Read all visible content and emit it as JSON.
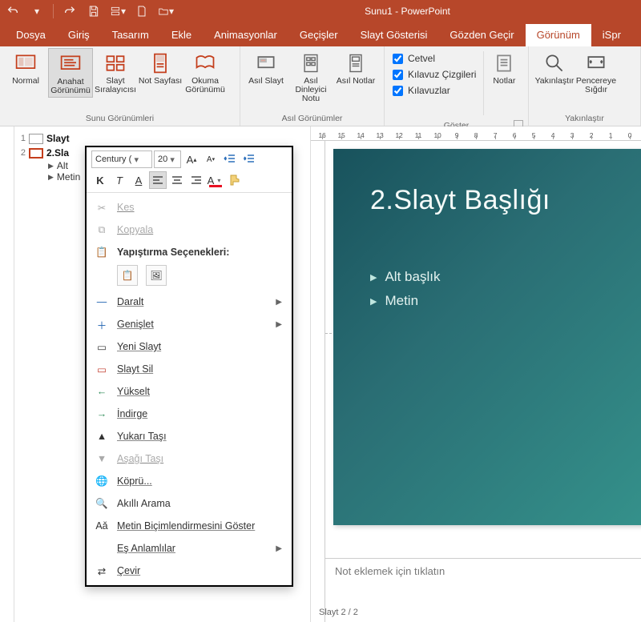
{
  "titlebar": {
    "title": "Sunu1 - PowerPoint"
  },
  "tabs": {
    "file": "Dosya",
    "home": "Giriş",
    "design": "Tasarım",
    "insert": "Ekle",
    "anim": "Animasyonlar",
    "trans": "Geçişler",
    "show": "Slayt Gösterisi",
    "review": "Gözden Geçir",
    "view": "Görünüm",
    "ispring": "iSpr"
  },
  "ribbon": {
    "group_pres_views": "Sunu Görünümleri",
    "group_master_views": "Asıl Görünümler",
    "group_show": "Göster",
    "group_zoom": "Yakınlaştır",
    "btn_normal": "Normal",
    "btn_outline": "Anahat Görünümü",
    "btn_sorter": "Slayt Sıralayıcısı",
    "btn_notespage": "Not Sayfası",
    "btn_reading": "Okuma Görünümü",
    "btn_slidemaster": "Asıl Slayt",
    "btn_handoutmaster": "Asıl Dinleyici Notu",
    "btn_notesmaster": "Asıl Notlar",
    "chk_ruler": "Cetvel",
    "chk_gridlines": "Kılavuz Çizgileri",
    "chk_guides": "Kılavuzlar",
    "btn_notes": "Notlar",
    "btn_zoom": "Yakınlaştır",
    "btn_fit": "Pencereye Sığdır"
  },
  "outline": {
    "s1_num": "1",
    "s1_title": "Slayt",
    "s2_num": "2",
    "s2_title": "2.Sla",
    "s2_sub1": "Alt",
    "s2_sub2": "Metin"
  },
  "minitoolbar": {
    "font": "Century (",
    "size": "20"
  },
  "contextmenu": {
    "cut": "Kes",
    "copy": "Kopyala",
    "paste_header": "Yapıştırma Seçenekleri:",
    "collapse": "Daralt",
    "expand": "Genişlet",
    "newslide": "Yeni Slayt",
    "deleteslide": "Slayt Sil",
    "promote": "Yükselt",
    "demote": "İndirge",
    "moveup": "Yukarı Taşı",
    "movedown": "Aşağı Taşı",
    "hyperlink": "Köprü...",
    "smartlookup": "Akıllı Arama",
    "showfmt": "Metin Biçimlendirmesini Göster",
    "synonyms": "Eş Anlamlılar",
    "translate": "Çevir"
  },
  "slide": {
    "title": "2.Slayt Başlığı",
    "b1": "Alt başlık",
    "b2": "Metin"
  },
  "ruler": [
    "16",
    "15",
    "14",
    "13",
    "12",
    "11",
    "10",
    "9",
    "8",
    "7",
    "6",
    "5",
    "4",
    "3",
    "2",
    "1",
    "0"
  ],
  "notes_placeholder": "Not eklemek için tıklatın",
  "status": "Slayt 2 / 2"
}
